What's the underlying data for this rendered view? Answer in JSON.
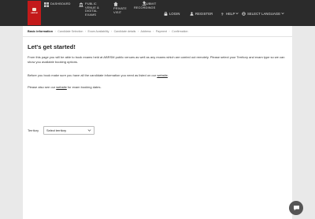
{
  "brand": {
    "logo_text": "ABRSM"
  },
  "nav": {
    "dashboard": "DASHBOARD",
    "public_venue": [
      "PUBLIC",
      "VENUE &",
      "DIGITAL",
      "EXAMS"
    ],
    "private_visit": [
      "PRIVATE",
      "VISIT"
    ],
    "submit_recordings": [
      "SUBMIT",
      "RECORDINGS"
    ],
    "login": "LOGIN",
    "register": "REGISTER",
    "help": "HELP",
    "language": "SELECT LANGUAGE"
  },
  "breadcrumbs": [
    "Basic information",
    "Candidate Selection",
    "Exam Availability",
    "Candidate details",
    "Address",
    "Payment",
    "Confirmation"
  ],
  "page": {
    "title": "Let's get started!",
    "para1": "From this page you will be able to book exams held at ABRSM public venues as well as any exams which are carried out remotely. Please select your Territory and exam type so we can show you available booking options.",
    "para2_before": "Before you book make sure you have all the candidate information you need as listed on our ",
    "para2_link": "website",
    "para2_after": ".",
    "para3_before": "Please also see our ",
    "para3_link": "website",
    "para3_after": " for exam booking dates."
  },
  "territory": {
    "label": "Territory",
    "value": "Select territory"
  },
  "colors": {
    "topbar": "#2b2b2b",
    "brand_red": "#c31a1a",
    "background": "#e9e9e9",
    "chat_button": "#555555"
  },
  "icons": [
    "grid-icon",
    "building-icon",
    "house-icon",
    "upload-icon",
    "lock-icon",
    "user-icon",
    "question-icon",
    "globe-icon",
    "chevron-down-icon",
    "chat-icon"
  ]
}
